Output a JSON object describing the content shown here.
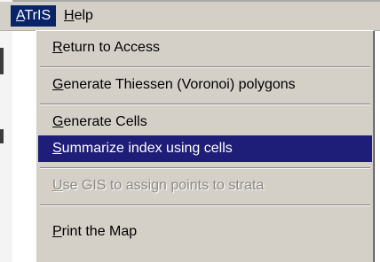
{
  "menubar": {
    "items": [
      {
        "accel": "A",
        "rest": "TrIS",
        "active": true
      },
      {
        "accel": "H",
        "rest": "elp",
        "active": false
      }
    ]
  },
  "menu": {
    "items": [
      {
        "accel": "R",
        "rest": "eturn to Access",
        "state": "normal"
      },
      {
        "accel": "G",
        "rest": "enerate Thiessen (Voronoi) polygons",
        "state": "normal"
      },
      {
        "accel": "G",
        "rest": "enerate Cells",
        "state": "normal"
      },
      {
        "accel": "S",
        "rest": "ummarize index using cells",
        "state": "highlighted"
      },
      {
        "accel": "U",
        "rest": "se GIS to assign points to strata",
        "state": "disabled"
      },
      {
        "accel": "P",
        "rest": "rint the Map",
        "state": "normal"
      }
    ]
  },
  "colors": {
    "menu_background": "#d4d0c8",
    "active_title_background": "#0a246a",
    "highlight_background": "#1e1e78",
    "highlight_text": "#ffffff",
    "disabled_text": "#8d8a84"
  }
}
